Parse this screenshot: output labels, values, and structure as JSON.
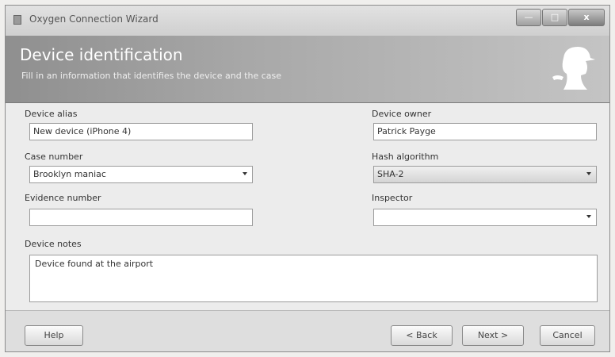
{
  "window": {
    "title": "Oxygen Connection Wizard",
    "controls": {
      "minimize": "—",
      "maximize": "□",
      "close": "x"
    }
  },
  "header": {
    "title": "Device identification",
    "subtitle": "Fill in an information that identifies the device and the case"
  },
  "form": {
    "device_alias": {
      "label": "Device alias",
      "value": "New device (iPhone 4)"
    },
    "device_owner": {
      "label": "Device owner",
      "value": "Patrick Payge"
    },
    "case_number": {
      "label": "Case number",
      "value": "Brooklyn maniac"
    },
    "hash_algorithm": {
      "label": "Hash algorithm",
      "value": "SHA-2"
    },
    "evidence_number": {
      "label": "Evidence number",
      "value": ""
    },
    "inspector": {
      "label": "Inspector",
      "value": ""
    },
    "device_notes": {
      "label": "Device notes",
      "value": "Device found at the airport"
    }
  },
  "footer": {
    "help": "Help",
    "back": "< Back",
    "next": "Next >",
    "cancel": "Cancel"
  },
  "icons": {
    "app": "app-icon",
    "header": "sherlock-silhouette-icon"
  }
}
